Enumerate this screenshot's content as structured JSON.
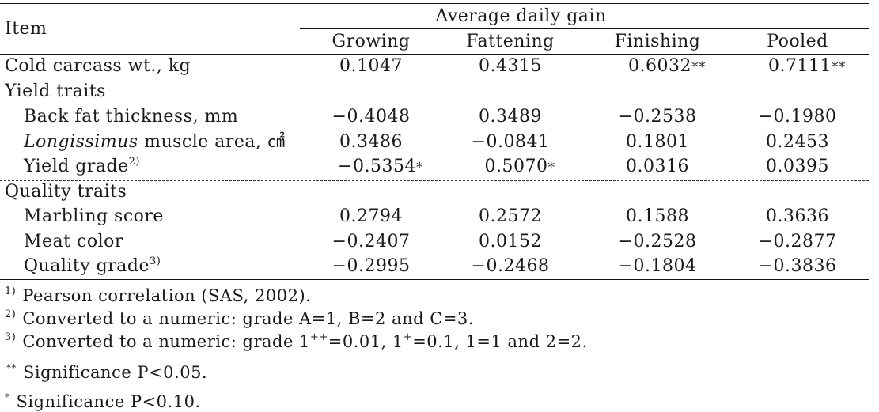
{
  "table": {
    "item_header": "Item",
    "group_header": "Average daily gain",
    "columns": [
      "Growing",
      "Fattening",
      "Finishing",
      "Pooled"
    ],
    "rows": [
      {
        "label": "Cold carcass wt., kg",
        "indent": false,
        "values": [
          "0.1047",
          "0.4315",
          "0.6032",
          "0.7111"
        ],
        "marks": [
          "",
          "",
          "**",
          "**"
        ]
      },
      {
        "label": "Yield traits",
        "indent": false,
        "section": true,
        "values": [
          "",
          "",
          "",
          ""
        ],
        "marks": [
          "",
          "",
          "",
          ""
        ]
      },
      {
        "label": "Back fat thickness, mm",
        "indent": true,
        "values": [
          "−0.4048",
          "0.3489",
          "−0.2538",
          "−0.1980"
        ],
        "marks": [
          "",
          "",
          "",
          ""
        ]
      },
      {
        "label_italic": "Longissimus",
        "label": " muscle area, ㎠",
        "indent": true,
        "values": [
          "0.3486",
          "−0.0841",
          "0.1801",
          "0.2453"
        ],
        "marks": [
          "",
          "",
          "",
          ""
        ]
      },
      {
        "label": "Yield grade",
        "label_sup": "2)",
        "indent": true,
        "values": [
          "−0.5354",
          "0.5070",
          "0.0316",
          "0.0395"
        ],
        "marks": [
          "*",
          "*",
          "",
          ""
        ]
      },
      {
        "label": "Quality traits",
        "indent": false,
        "section": true,
        "values": [
          "",
          "",
          "",
          ""
        ],
        "marks": [
          "",
          "",
          "",
          ""
        ]
      },
      {
        "label": "Marbling score",
        "indent": true,
        "values": [
          "0.2794",
          "0.2572",
          "0.1588",
          "0.3636"
        ],
        "marks": [
          "",
          "",
          "",
          ""
        ]
      },
      {
        "label": "Meat color",
        "indent": true,
        "values": [
          "−0.2407",
          "0.0152",
          "−0.2528",
          "−0.2877"
        ],
        "marks": [
          "",
          "",
          "",
          ""
        ]
      },
      {
        "label": "Quality grade",
        "label_sup": "3)",
        "indent": true,
        "values": [
          "−0.2995",
          "−0.2468",
          "−0.1804",
          "−0.3836"
        ],
        "marks": [
          "",
          "",
          "",
          ""
        ]
      }
    ]
  },
  "footnotes": [
    {
      "mark": "1)",
      "text": "Pearson correlation (SAS, 2002)."
    },
    {
      "mark": "2)",
      "text": "Converted to a numeric: grade A=1, B=2 and C=3."
    },
    {
      "mark": "3)",
      "text_parts": [
        "Converted to a numeric: grade 1",
        "++",
        "=0.01, 1",
        "+",
        "=0.1, 1=1 and 2=2."
      ]
    },
    {
      "mark": "**",
      "text": "Significance P<0.05."
    },
    {
      "mark": "*",
      "text": "Significance P<0.10."
    }
  ]
}
